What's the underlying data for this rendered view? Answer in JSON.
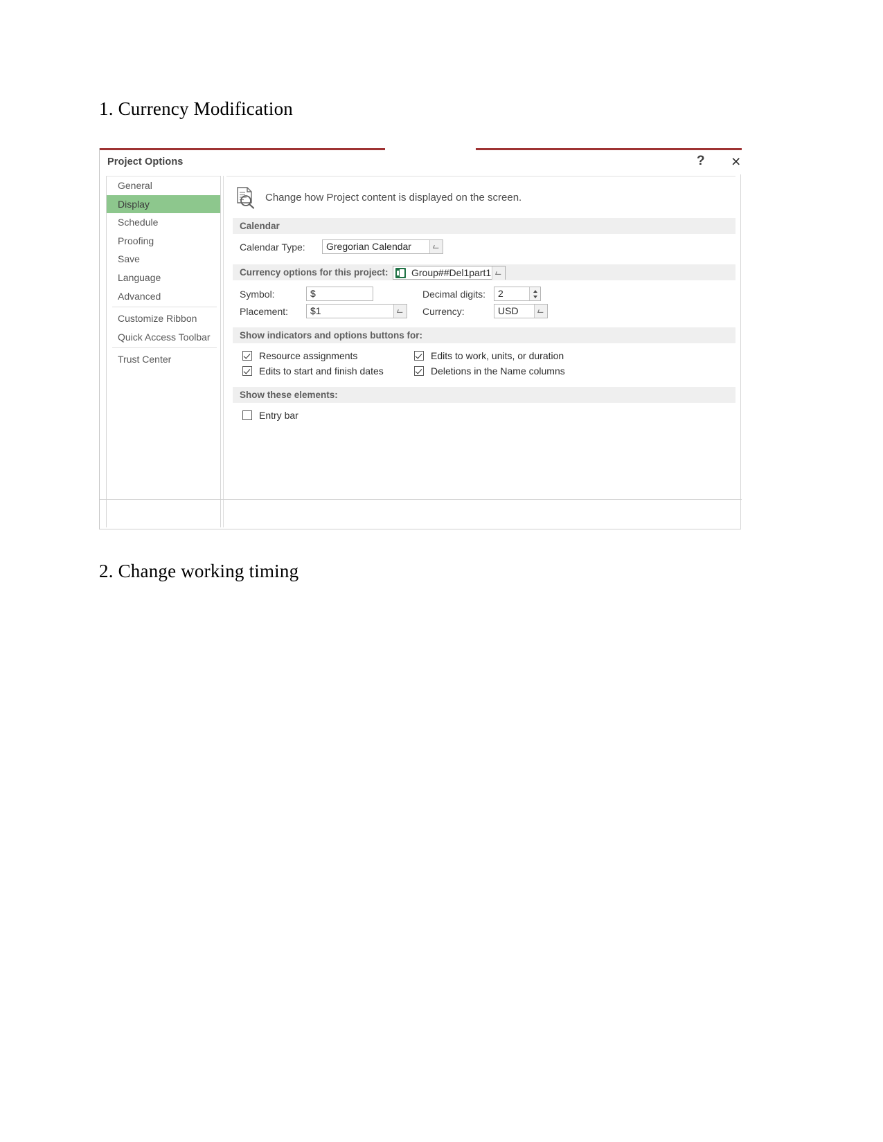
{
  "document": {
    "heading_1": "1. Currency Modification",
    "heading_2": "2. Change working timing"
  },
  "dialog": {
    "title": "Project Options",
    "help_label": "?",
    "close_label": "×",
    "accent_color": "#9e3233",
    "selected_color": "#8dc78d",
    "nav": {
      "items": [
        {
          "label": "General",
          "selected": false
        },
        {
          "label": "Display",
          "selected": true
        },
        {
          "label": "Schedule",
          "selected": false
        },
        {
          "label": "Proofing",
          "selected": false
        },
        {
          "label": "Save",
          "selected": false
        },
        {
          "label": "Language",
          "selected": false
        },
        {
          "label": "Advanced",
          "selected": false
        },
        {
          "label": "Customize Ribbon",
          "selected": false
        },
        {
          "label": "Quick Access Toolbar",
          "selected": false
        },
        {
          "label": "Trust Center",
          "selected": false
        }
      ]
    },
    "content": {
      "intro_text": "Change how Project content is displayed on the screen.",
      "intro_icon": "document-magnifier-icon",
      "calendar": {
        "band_label": "Calendar",
        "type_label": "Calendar Type:",
        "type_value": "Gregorian Calendar"
      },
      "currency": {
        "band_label": "Currency options for this project:",
        "project_value": "Group##Del1part1",
        "project_icon": "project-file-icon",
        "symbol_label": "Symbol:",
        "symbol_value": "$",
        "decimal_label": "Decimal digits:",
        "decimal_value": "2",
        "placement_label": "Placement:",
        "placement_value": "$1",
        "currency_label": "Currency:",
        "currency_value": "USD"
      },
      "indicators": {
        "band_label": "Show indicators and options buttons for:",
        "items": [
          {
            "label": "Resource assignments",
            "checked": true
          },
          {
            "label": "Edits to work, units, or duration",
            "checked": true
          },
          {
            "label": "Edits to start and finish dates",
            "checked": true
          },
          {
            "label": "Deletions in the Name columns",
            "checked": true
          }
        ]
      },
      "elements": {
        "band_label": "Show these elements:",
        "items": [
          {
            "label": "Entry bar",
            "checked": false
          }
        ]
      }
    }
  }
}
